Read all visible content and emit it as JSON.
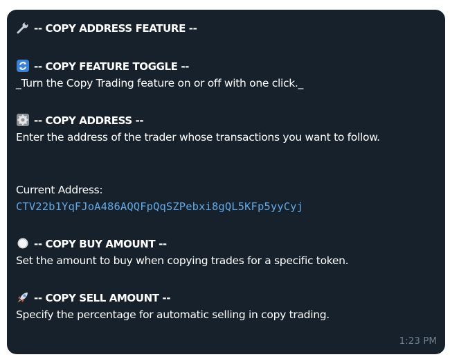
{
  "message": {
    "header": {
      "icon": "wrench-icon",
      "title": "-- COPY ADDRESS FEATURE --"
    },
    "sections": {
      "toggle": {
        "icon": "refresh-icon",
        "title": "-- COPY FEATURE TOGGLE --",
        "text": "_Turn the Copy Trading feature on or off with one click._"
      },
      "address": {
        "icon": "gear-icon",
        "title": "-- COPY ADDRESS --",
        "text": "Enter the address of the trader whose transactions you want to follow.",
        "current_label": "Current Address:",
        "current_value": "CTV22b1YqFJoA486AQQFpQqSZPebxi8gQL5KFp5yyCyj"
      },
      "buy": {
        "icon": "white-circle-icon",
        "title": "-- COPY BUY AMOUNT --",
        "text": "Set the amount to buy when copying trades for a specific token."
      },
      "sell": {
        "icon": "rocket-icon",
        "title": "-- COPY SELL AMOUNT --",
        "text": "Specify the percentage for automatic selling in copy trading."
      }
    },
    "timestamp": "1:23 PM"
  },
  "colors": {
    "bubble_background": "#17212b",
    "text": "#ffffff",
    "address_link": "#62a8e6",
    "timestamp": "#6d7f8f"
  }
}
